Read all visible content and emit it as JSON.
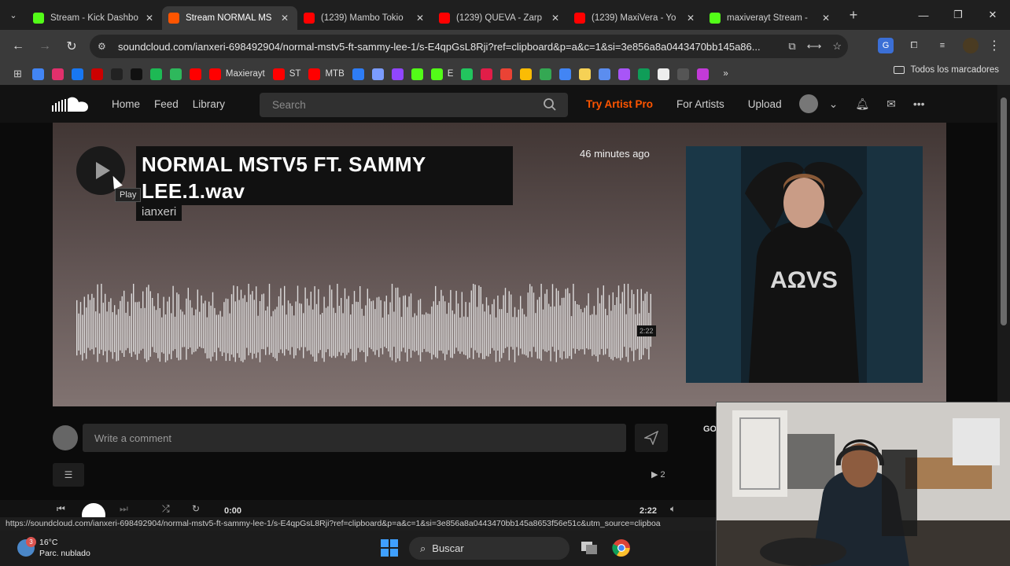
{
  "browser": {
    "tabs": [
      {
        "title": "Stream - Kick Dashbo",
        "favicon": "kick-icon",
        "color": "#53fc18",
        "active": false
      },
      {
        "title": "Stream NORMAL MS",
        "favicon": "soundcloud-icon",
        "color": "#ff5500",
        "active": true
      },
      {
        "title": "(1239) Mambo Tokio",
        "favicon": "youtube-icon",
        "color": "#ff0000",
        "active": false
      },
      {
        "title": "(1239) QÜEVA - Zarp",
        "favicon": "youtube-icon",
        "color": "#ff0000",
        "active": false
      },
      {
        "title": "(1239) MaxiVera - Yo",
        "favicon": "youtube-icon",
        "color": "#ff0000",
        "active": false
      },
      {
        "title": "maxiverayt Stream - ",
        "favicon": "kick-icon",
        "color": "#53fc18",
        "active": false
      }
    ],
    "url": "soundcloud.com/ianxeri-698492904/normal-mstv5-ft-sammy-lee-1/s-E4qpGsL8Rji?ref=clipboard&p=a&c=1&si=3e856a8a0443470bb145a86...",
    "bookmarks": [
      {
        "label": "",
        "icon": "google-icon",
        "color": "#4285f4"
      },
      {
        "label": "",
        "icon": "instagram-icon",
        "color": "#e1306c"
      },
      {
        "label": "",
        "icon": "facebook-icon",
        "color": "#1877f2"
      },
      {
        "label": "",
        "icon": "red-icon",
        "color": "#cc0000"
      },
      {
        "label": "",
        "icon": "x-icon",
        "color": "#222222"
      },
      {
        "label": "",
        "icon": "tiktok-icon",
        "color": "#111111"
      },
      {
        "label": "",
        "icon": "spotify-icon",
        "color": "#1db954"
      },
      {
        "label": "",
        "icon": "s2-icon",
        "color": "#2eb85c"
      },
      {
        "label": "",
        "icon": "youtube-icon",
        "color": "#ff0000"
      },
      {
        "label": "Maxierayt",
        "icon": "youtube-icon",
        "color": "#ff0000"
      },
      {
        "label": "ST",
        "icon": "youtube-icon",
        "color": "#ff0000"
      },
      {
        "label": "MTB",
        "icon": "youtube-icon",
        "color": "#ff0000"
      },
      {
        "label": "",
        "icon": "c-icon",
        "color": "#2e7df6"
      },
      {
        "label": "",
        "icon": "gemini-icon",
        "color": "#7b9cff"
      },
      {
        "label": "",
        "icon": "twitch-icon",
        "color": "#9146ff"
      },
      {
        "label": "",
        "icon": "kick-icon",
        "color": "#53fc18"
      },
      {
        "label": "E",
        "icon": "kick-icon",
        "color": "#53fc18"
      },
      {
        "label": "",
        "icon": "d-icon",
        "color": "#22c55e"
      },
      {
        "label": "",
        "icon": "play-circle-icon",
        "color": "#e11d48"
      },
      {
        "label": "",
        "icon": "gmail-icon",
        "color": "#ea4335"
      },
      {
        "label": "",
        "icon": "drive-icon",
        "color": "#fbbc04"
      },
      {
        "label": "",
        "icon": "maps-icon",
        "color": "#34a853"
      },
      {
        "label": "",
        "icon": "docs-icon",
        "color": "#4285f4"
      },
      {
        "label": "",
        "icon": "yellow-icon",
        "color": "#f6d155"
      },
      {
        "label": "",
        "icon": "translate-icon",
        "color": "#5b8def"
      },
      {
        "label": "",
        "icon": "purple-icon",
        "color": "#a855f7"
      },
      {
        "label": "",
        "icon": "sheets-icon",
        "color": "#0f9d58"
      },
      {
        "label": "",
        "icon": "white-icon",
        "color": "#eeeeee"
      },
      {
        "label": "",
        "icon": "grid-icon",
        "color": "#555555"
      },
      {
        "label": "",
        "icon": "dots-icon",
        "color": "#c23ad8"
      }
    ],
    "all_bookmarks": "Todos los marcadores"
  },
  "soundcloud": {
    "nav": [
      "Home",
      "Feed",
      "Library"
    ],
    "search_placeholder": "Search",
    "try_pro": "Try Artist Pro",
    "for_artists": "For Artists",
    "upload": "Upload",
    "track": {
      "title": "NORMAL MSTV5 FT. SAMMY LEE.1.wav",
      "artist": "ianxeri",
      "posted": "46 minutes ago",
      "duration_tag": "2:22",
      "tooltip": "Play"
    },
    "comment_placeholder": "Write a comment",
    "go_label": "GO",
    "repost_count": "2",
    "player": {
      "current": "0:00",
      "total": "2:22"
    }
  },
  "statusbar_url": "https://soundcloud.com/ianxeri-698492904/normal-mstv5-ft-sammy-lee-1/s-E4qpGsL8Rji?ref=clipboard&p=a&c=1&si=3e856a8a0443470bb145a8653f56e51c&utm_source=clipboa",
  "taskbar": {
    "temperature": "16°C",
    "weather": "Parc. nublado",
    "weather_badge": "3",
    "search": "Buscar"
  }
}
